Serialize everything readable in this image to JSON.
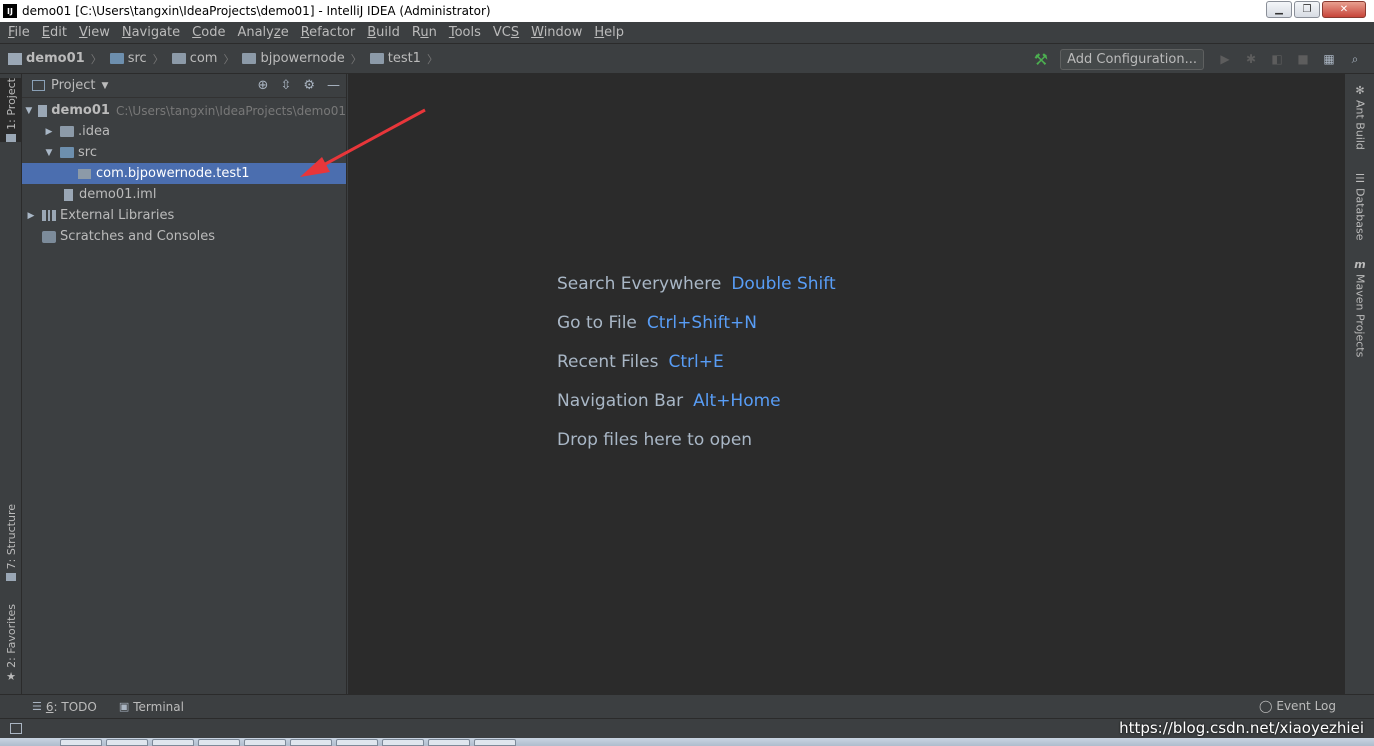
{
  "window": {
    "title": "demo01 [C:\\Users\\tangxin\\IdeaProjects\\demo01] - IntelliJ IDEA (Administrator)",
    "app_icon_text": "IJ"
  },
  "menu": [
    {
      "prefix": "",
      "u": "F",
      "rest": "ile"
    },
    {
      "prefix": "",
      "u": "E",
      "rest": "dit"
    },
    {
      "prefix": "",
      "u": "V",
      "rest": "iew"
    },
    {
      "prefix": "",
      "u": "N",
      "rest": "avigate"
    },
    {
      "prefix": "",
      "u": "C",
      "rest": "ode"
    },
    {
      "prefix": "Analy",
      "u": "z",
      "rest": "e"
    },
    {
      "prefix": "",
      "u": "R",
      "rest": "efactor"
    },
    {
      "prefix": "",
      "u": "B",
      "rest": "uild"
    },
    {
      "prefix": "R",
      "u": "u",
      "rest": "n"
    },
    {
      "prefix": "",
      "u": "T",
      "rest": "ools"
    },
    {
      "prefix": "VC",
      "u": "S",
      "rest": ""
    },
    {
      "prefix": "",
      "u": "W",
      "rest": "indow"
    },
    {
      "prefix": "",
      "u": "H",
      "rest": "elp"
    }
  ],
  "breadcrumb": [
    "demo01",
    "src",
    "com",
    "bjpowernode",
    "test1"
  ],
  "toolbar": {
    "add_config": "Add Configuration..."
  },
  "left_tabs": {
    "project": "1: Project",
    "structure": "7: Structure",
    "favorites": "2: Favorites"
  },
  "project_panel": {
    "title": "Project",
    "tree": [
      {
        "label": "demo01",
        "path": "C:\\Users\\tangxin\\IdeaProjects\\demo01"
      },
      {
        "label": ".idea"
      },
      {
        "label": "src"
      },
      {
        "label": "com.bjpowernode.test1"
      },
      {
        "label": "demo01.iml"
      },
      {
        "label": "External Libraries"
      },
      {
        "label": "Scratches and Consoles"
      }
    ]
  },
  "editor_hints": [
    {
      "text": "Search Everywhere",
      "key": "Double Shift"
    },
    {
      "text": "Go to File",
      "key": "Ctrl+Shift+N"
    },
    {
      "text": "Recent Files",
      "key": "Ctrl+E"
    },
    {
      "text": "Navigation Bar",
      "key": "Alt+Home"
    },
    {
      "text": "Drop files here to open",
      "key": ""
    }
  ],
  "right_tabs": {
    "ant": "Ant Build",
    "database": "Database",
    "maven": "Maven Projects"
  },
  "bottom": {
    "todo_num": "6",
    "todo_rest": ": TODO",
    "terminal": "Terminal",
    "event_log": "Event Log"
  },
  "watermark": "https://blog.csdn.net/xiaoyezhiei",
  "colors": {
    "selection": "#4b6eaf",
    "shortcut": "#589df6",
    "annotation_arrow": "#e8363a"
  }
}
